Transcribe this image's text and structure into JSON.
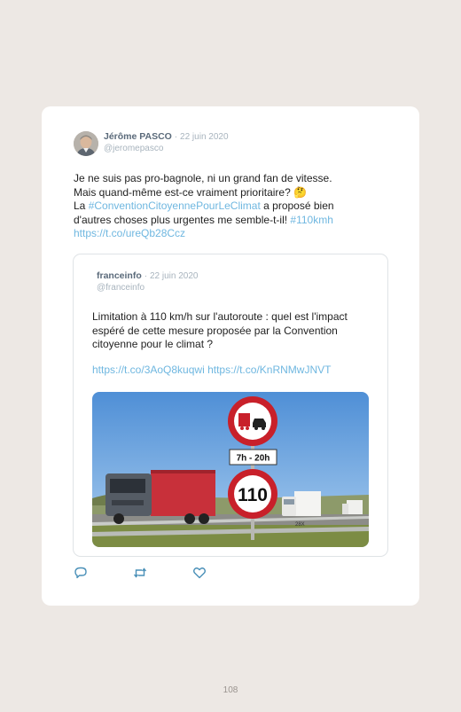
{
  "tweet": {
    "author_name": "Jérôme PASCO",
    "separator": "·",
    "date": "22 juin 2020",
    "handle": "@jeromepasco",
    "line1": "Je ne suis pas pro-bagnole, ni un grand fan de vitesse.",
    "line2": "Mais quand-même est-ce vraiment prioritaire? 🤔",
    "line3_prefix": "La ",
    "hashtag1": "#ConventionCitoyennePourLeClimat",
    "line3_suffix": " a proposé bien",
    "line4": "d'autres choses plus urgentes me semble-t-il! ",
    "hashtag2": "#110kmh",
    "link": "https://t.co/ureQb28Ccz"
  },
  "quoted": {
    "author_name": "franceinfo",
    "separator": "·",
    "date": "22 juin 2020",
    "handle": "@franceinfo",
    "text": "Limitation à 110 km/h sur l'autoroute : quel est l'impact espéré de cette mesure proposée par la Convention citoyenne pour le climat ?",
    "link1": "https://t.co/3AoQ8kuqwi",
    "link2": "https://t.co/KnRNMwJNVT",
    "image": {
      "sign_time": "7h - 20h",
      "sign_speed": "110",
      "truck_plate": "28X"
    }
  },
  "actions": {
    "reply_icon": "reply-icon",
    "retweet_icon": "retweet-icon",
    "like_icon": "heart-icon"
  },
  "footer": {
    "page_number": "108"
  },
  "colors": {
    "background": "#ede8e4",
    "link": "#6fb7e0",
    "name": "#5a6a7a",
    "meta": "#a8b4be"
  }
}
